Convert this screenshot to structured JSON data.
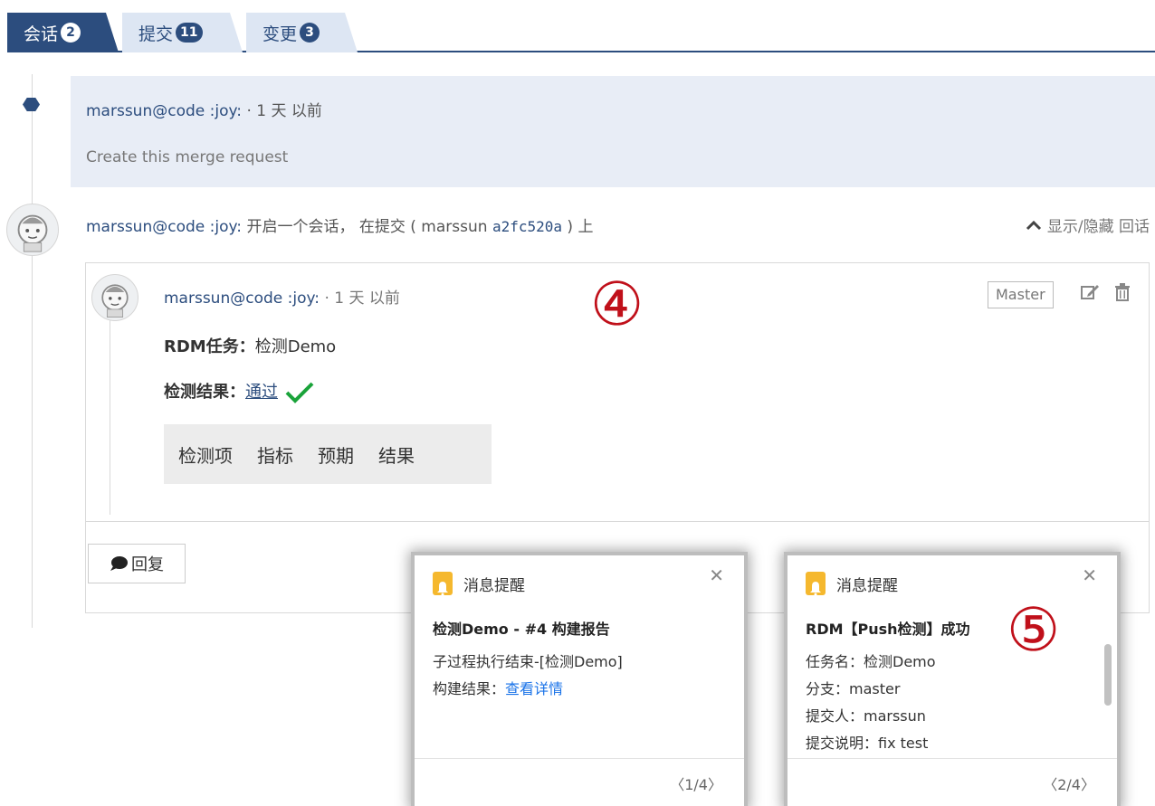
{
  "tabs": [
    {
      "label": "会话",
      "count": "2"
    },
    {
      "label": "提交",
      "count": "11"
    },
    {
      "label": "变更",
      "count": "3"
    }
  ],
  "event": {
    "author": "marssun@code :joy:",
    "time": "· 1 天 以前",
    "description": "Create this merge request"
  },
  "discussion": {
    "author": "marssun@code :joy:",
    "text_start": "开启一个会话， 在提交 ( marssun",
    "commit": "a2fc520a",
    "text_end": ") 上",
    "toggle_label": "显示/隐藏 回话"
  },
  "note": {
    "author": "marssun@code :joy:",
    "time": "· 1 天 以前",
    "branch_badge": "Master",
    "task_label": "RDM任务：",
    "task_value": "检测Demo",
    "result_label": "检测结果：",
    "result_link": "通过",
    "table_headers": [
      "检测项",
      "指标",
      "预期",
      "结果"
    ],
    "reply_label": "回复"
  },
  "annotations": {
    "circle4": "④",
    "circle5": "⑤"
  },
  "notifications": [
    {
      "header": "消息提醒",
      "title": "检测Demo - #4 构建报告",
      "line1": "子过程执行结束-[检测Demo]",
      "line2_label": "构建结果：",
      "line2_link": "查看详情",
      "pager": "1/4"
    },
    {
      "header": "消息提醒",
      "title": "RDM【Push检测】成功",
      "line1": "任务名：检测Demo",
      "line2": "分支：master",
      "line3": "提交人：marssun",
      "line4": "提交说明：fix test",
      "pager": "2/4"
    }
  ],
  "colors": {
    "accent": "#2c4d7e",
    "success": "#1aa33a",
    "annotation": "#c0101a",
    "bell": "#f5b82e"
  }
}
